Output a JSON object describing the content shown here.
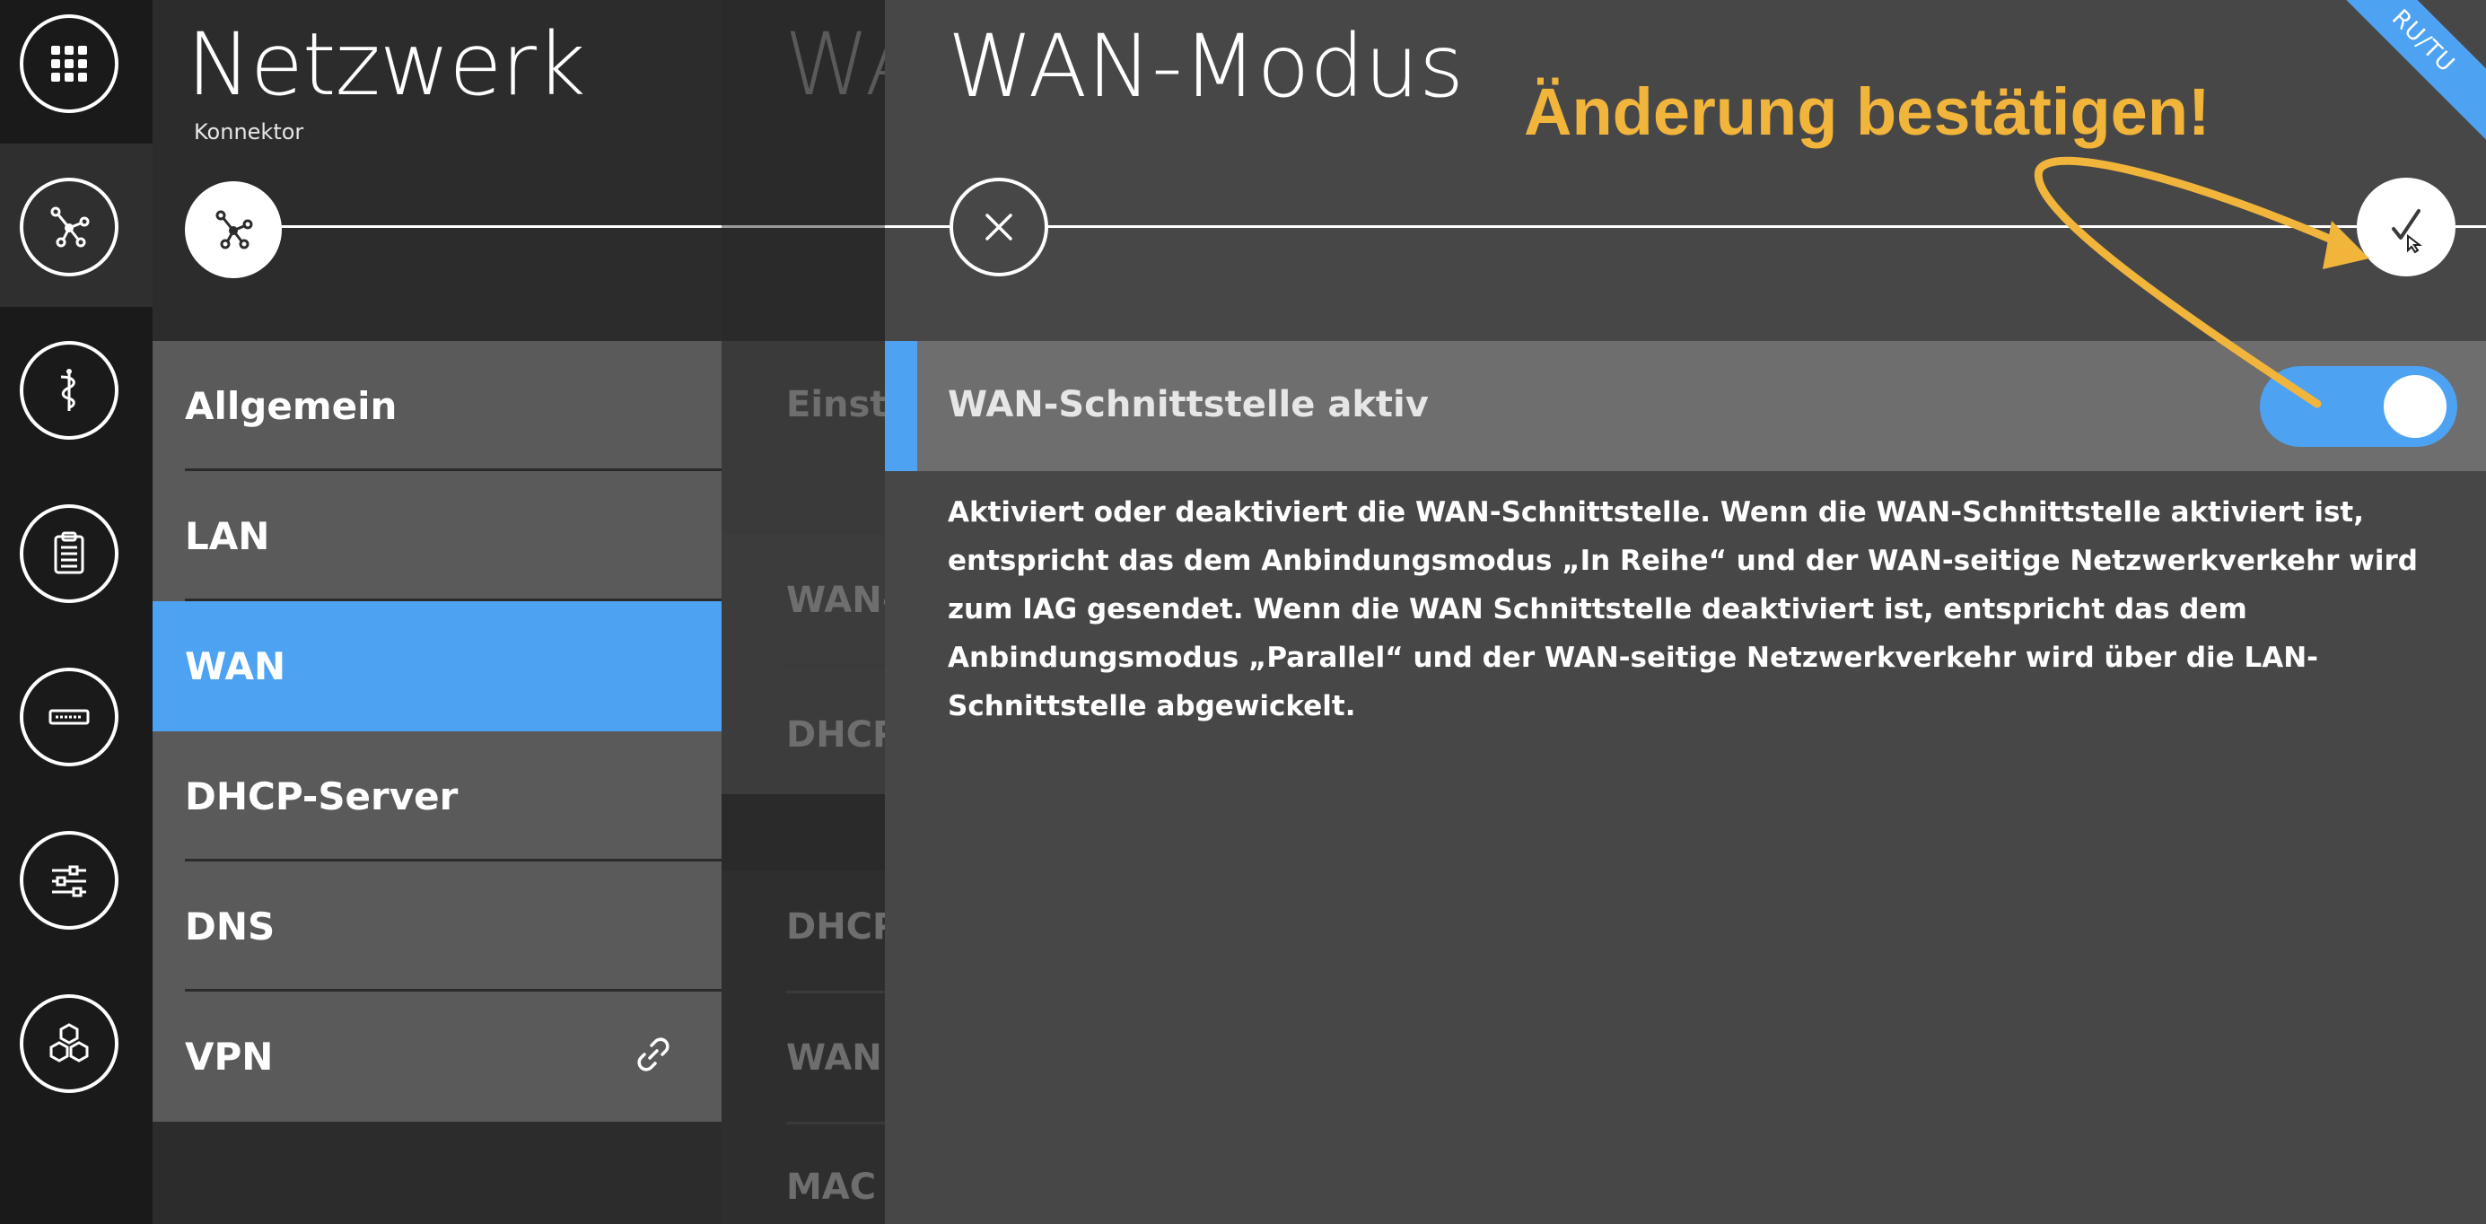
{
  "rail": {
    "items": [
      {
        "icon": "apps-grid-icon"
      },
      {
        "icon": "network-icon",
        "active": true
      },
      {
        "icon": "caduceus-icon"
      },
      {
        "icon": "clipboard-icon"
      },
      {
        "icon": "card-reader-icon"
      },
      {
        "icon": "sliders-icon"
      },
      {
        "icon": "hexagons-icon"
      }
    ]
  },
  "netzwerk": {
    "title": "Netzwerk",
    "subtitle": "Konnektor",
    "menu": [
      {
        "label": "Allgemein"
      },
      {
        "label": "LAN"
      },
      {
        "label": "WAN",
        "active": true
      },
      {
        "label": "DHCP-Server"
      },
      {
        "label": "DNS"
      },
      {
        "label": "VPN",
        "icon": "link-icon"
      }
    ]
  },
  "middle": {
    "title": "WA",
    "rows": [
      "Einste",
      "WAN-I",
      "DHCP",
      "DHCP",
      "WAN I",
      "MAC"
    ]
  },
  "wan_modus": {
    "title": "WAN-Modus",
    "ribbon": "RU/TU",
    "setting": {
      "label": "WAN-Schnittstelle aktiv",
      "enabled": true
    },
    "description": "Aktiviert oder deaktiviert die WAN-Schnittstelle. Wenn die WAN-Schnittstelle aktiviert ist, entspricht das dem Anbindungsmodus „In Reihe“ und der WAN-seitige Netzwerkverkehr wird zum IAG gesendet. Wenn die WAN Schnittstelle deaktiviert ist, entspricht das dem Anbindungsmodus „Parallel“ und der WAN-seitige Netzwerkverkehr wird über die LAN-Schnittstelle abgewickelt."
  },
  "annotation": {
    "text": "Änderung bestätigen!",
    "color": "#f2b53c"
  },
  "colors": {
    "accent": "#4da3f2",
    "rail_bg": "#1a1a1a",
    "menu_bg": "#5a5a5a",
    "panel_bg": "#474747"
  }
}
